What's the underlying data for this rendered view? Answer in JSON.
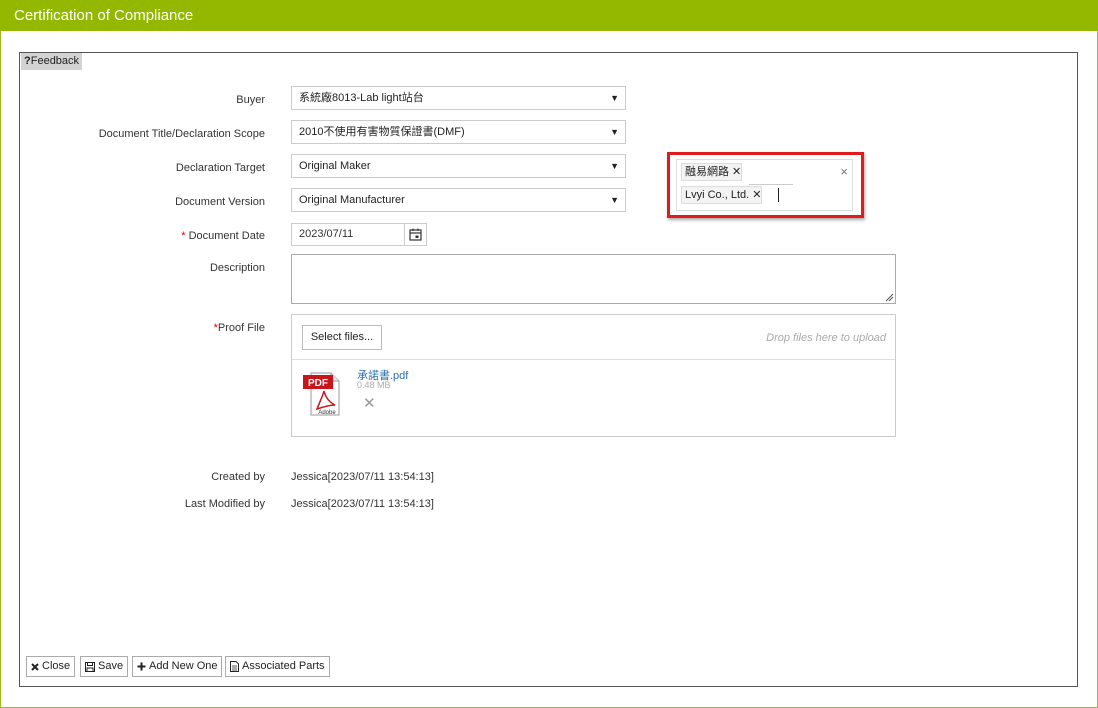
{
  "window": {
    "title": "Certification of Compliance"
  },
  "feedback": {
    "icon": "?",
    "label": "Feedback"
  },
  "form": {
    "buyer": {
      "label": "Buyer",
      "value": "系統廠8013-Lab light站台"
    },
    "doc_title": {
      "label": "Document Title/Declaration Scope",
      "value": "2010不使用有害物質保證書(DMF)"
    },
    "decl_target": {
      "label": "Declaration Target",
      "value": "Original Maker"
    },
    "doc_version": {
      "label": "Document Version",
      "value": "Original Manufacturer"
    },
    "doc_date": {
      "required_mark": "*",
      "label": "Document Date",
      "value": "2023/07/11"
    },
    "description": {
      "label": "Description",
      "value": ""
    },
    "proof_file": {
      "required_mark": "*",
      "label": "Proof File",
      "select_label": "Select files...",
      "drop_hint": "Drop files here to upload",
      "file": {
        "name": "承諾書.pdf",
        "size": "0.48 MB",
        "icon_text": "PDF",
        "icon_sub": "Adobe"
      }
    }
  },
  "meta": {
    "created_by_label": "Created by",
    "created_by_value": "Jessica[2023/07/11 13:54:13]",
    "modified_by_label": "Last Modified by",
    "modified_by_value": "Jessica[2023/07/11 13:54:13]"
  },
  "multiselect": {
    "tags": [
      "融易網路",
      "Lvyi Co., Ltd."
    ],
    "clear": "×"
  },
  "buttons": {
    "close": "Close",
    "save": "Save",
    "add_new": "Add New One",
    "associated": "Associated Parts"
  },
  "colors": {
    "title_bar": "#94b800",
    "highlight": "#e01b1b",
    "link": "#2a6fb0"
  }
}
